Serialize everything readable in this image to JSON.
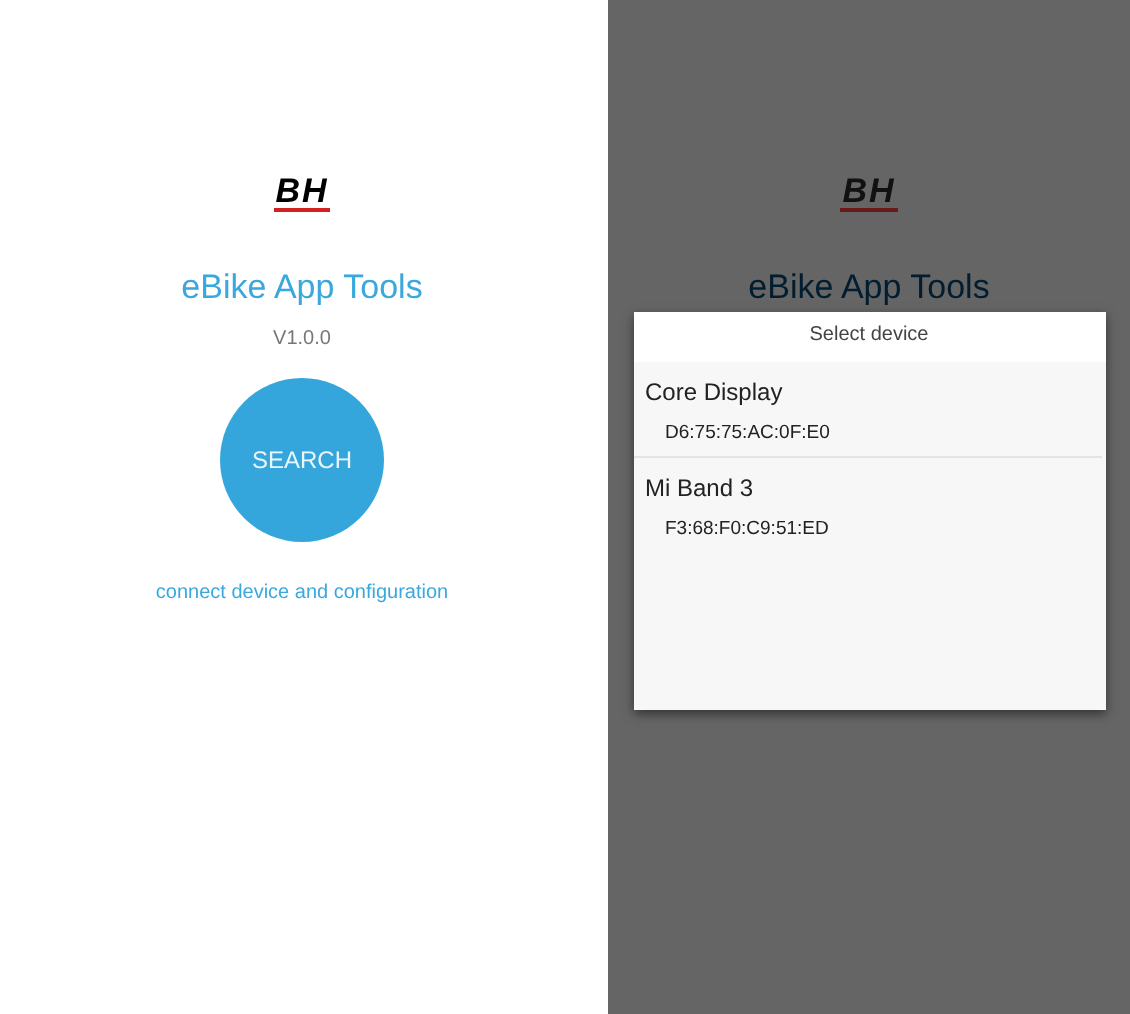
{
  "home_screen": {
    "logo": "BH",
    "title": "eBike App Tools",
    "version": "V1.0.0",
    "search_button": "SEARCH",
    "subtitle": "connect device and configuration"
  },
  "select_screen": {
    "logo": "BH",
    "title": "eBike App Tools",
    "dialog": {
      "title": "Select device",
      "devices": [
        {
          "name": "Core Display",
          "address": "D6:75:75:AC:0F:E0"
        },
        {
          "name": "Mi Band 3",
          "address": "F3:68:F0:C9:51:ED"
        }
      ]
    }
  }
}
